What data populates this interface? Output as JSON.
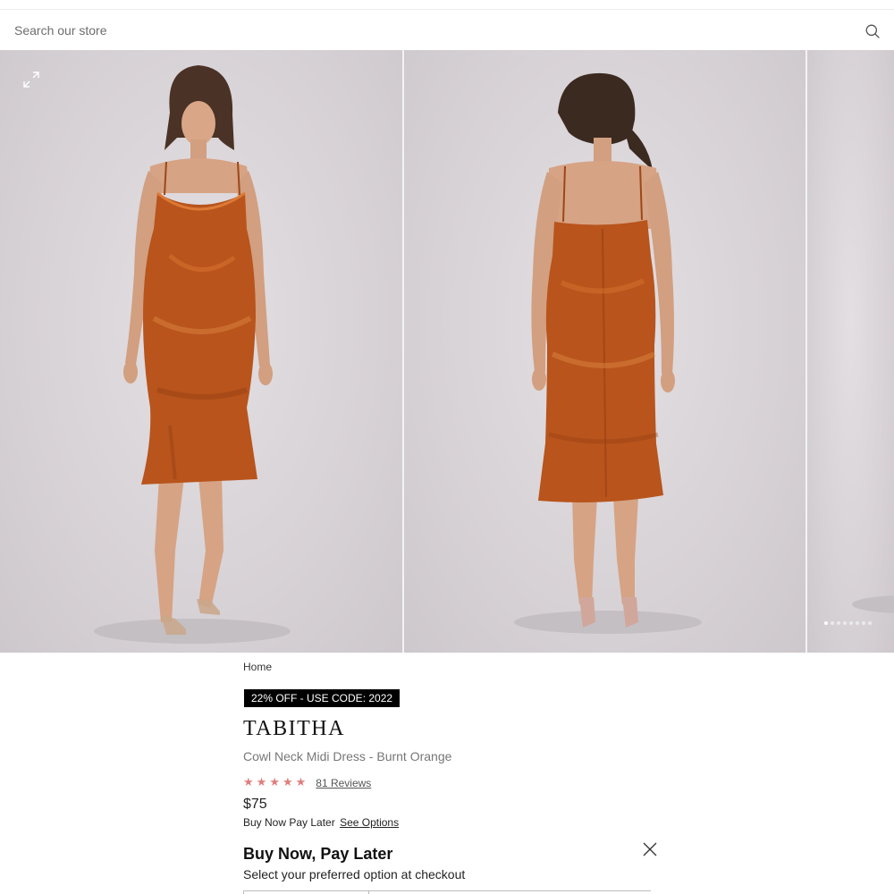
{
  "search": {
    "placeholder": "Search our store",
    "icon": "search-icon"
  },
  "gallery": {
    "expand_icon": "expand-icon",
    "slides": [
      {
        "view": "front",
        "dress_color": "#b8541c"
      },
      {
        "view": "back",
        "dress_color": "#b8541c"
      },
      {
        "view": "partial"
      }
    ],
    "dots_count": 8,
    "active_dot": 1
  },
  "product": {
    "breadcrumb": "Home",
    "promo": "22% OFF - USE CODE: 2022",
    "brand": "TABITHA",
    "name": "Cowl Neck Midi Dress - Burnt Orange",
    "rating": 5,
    "reviews": "81 Reviews",
    "price": "$75",
    "bnpl_text": "Buy Now Pay Later",
    "see_options": "See Options"
  },
  "bnpl_panel": {
    "title": "Buy Now, Pay Later",
    "subtitle": "Select your preferred option at checkout",
    "close_icon": "close-icon"
  },
  "colors": {
    "accent_star": "#e07d7d",
    "promo_bg": "#000000",
    "dress": "#b8541c"
  }
}
